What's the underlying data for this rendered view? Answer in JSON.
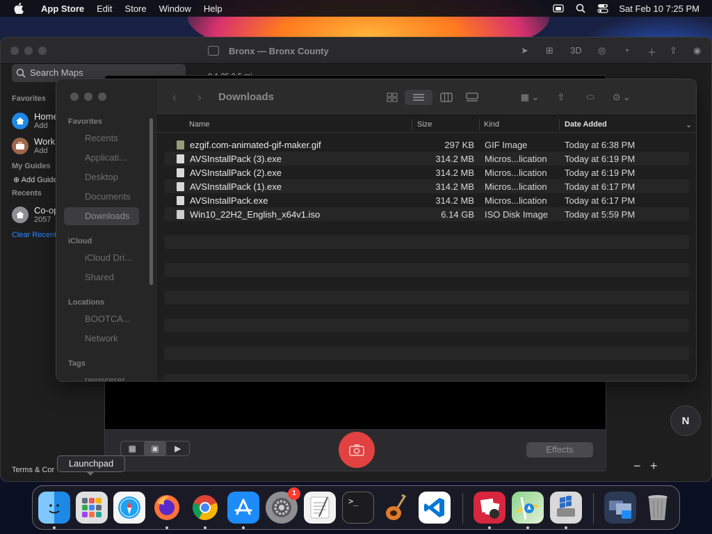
{
  "menubar": {
    "app_name": "App Store",
    "items": [
      "Edit",
      "Store",
      "Window",
      "Help"
    ],
    "clock": "Sat Feb 10  7:25 PM"
  },
  "maps": {
    "title": "Bronx — Bronx County",
    "toolbar_3d": "3D",
    "search_placeholder": "Search Maps",
    "favorites_heading": "Favorites",
    "favorites": [
      {
        "name": "Home",
        "sub": "Add"
      },
      {
        "name": "Work",
        "sub": "Add"
      }
    ],
    "guides_heading": "My Guides",
    "add_guide": "Add Guide",
    "recents_heading": "Recents",
    "recent": {
      "name": "Co-op",
      "sub": "2057"
    },
    "clear_recents": "Clear Recents",
    "terms": "Terms & Cor",
    "distances": "0      1.25      2.5 mi",
    "compass": "N",
    "zoom_out": "−",
    "zoom_in": "+"
  },
  "photobooth": {
    "effects_label": "Effects"
  },
  "finder": {
    "title": "Downloads",
    "sidebar": {
      "favorites_heading": "Favorites",
      "favorites": [
        "Recents",
        "Applicati...",
        "Desktop",
        "Documents",
        "Downloads"
      ],
      "icloud_heading": "iCloud",
      "icloud": [
        "iCloud Dri...",
        "Shared"
      ],
      "locations_heading": "Locations",
      "locations": [
        "BOOTCA...",
        "Network"
      ],
      "tags_heading": "Tags",
      "tags": [
        "rewwrerer"
      ]
    },
    "columns": {
      "name": "Name",
      "size": "Size",
      "kind": "Kind",
      "date": "Date Added"
    },
    "files": [
      {
        "name": "ezgif.com-animated-gif-maker.gif",
        "size": "297 KB",
        "kind": "GIF Image",
        "date": "Today at 6:38 PM"
      },
      {
        "name": "AVSInstallPack (3).exe",
        "size": "314.2 MB",
        "kind": "Micros...lication",
        "date": "Today at 6:19 PM"
      },
      {
        "name": "AVSInstallPack (2).exe",
        "size": "314.2 MB",
        "kind": "Micros...lication",
        "date": "Today at 6:19 PM"
      },
      {
        "name": "AVSInstallPack (1).exe",
        "size": "314.2 MB",
        "kind": "Micros...lication",
        "date": "Today at 6:17 PM"
      },
      {
        "name": "AVSInstallPack.exe",
        "size": "314.2 MB",
        "kind": "Micros...lication",
        "date": "Today at 6:17 PM"
      },
      {
        "name": "Win10_22H2_English_x64v1.iso",
        "size": "6.14 GB",
        "kind": "ISO Disk Image",
        "date": "Today at 5:59 PM"
      }
    ]
  },
  "tooltip": "Launchpad",
  "dock": {
    "apps": [
      {
        "name": "finder-icon",
        "color": "#1e88e5"
      },
      {
        "name": "launchpad-icon",
        "color": "#d9d9d9"
      },
      {
        "name": "safari-icon",
        "color": "#1ea1f2"
      },
      {
        "name": "firefox-icon",
        "color": "#ff7139"
      },
      {
        "name": "chrome-icon",
        "color": "#ffffff"
      },
      {
        "name": "app-store-icon",
        "color": "#1d8cf8"
      },
      {
        "name": "system-settings-icon",
        "color": "#8e8e93"
      },
      {
        "name": "textedit-icon",
        "color": "#f2f2f2"
      },
      {
        "name": "terminal-icon",
        "color": "#1c1c1e"
      },
      {
        "name": "garageband-icon",
        "color": "#3a2a1a"
      },
      {
        "name": "vscode-icon",
        "color": "#0078d4"
      },
      {
        "name": "photo-booth-icon",
        "color": "#d7263d"
      },
      {
        "name": "maps-icon",
        "color": "#4caf50"
      },
      {
        "name": "boot-camp-assistant-icon",
        "color": "#bdbdbd"
      },
      {
        "name": "downloads-stack-icon",
        "color": "#2b3a55"
      },
      {
        "name": "trash-icon",
        "color": "#9e9e9e"
      }
    ],
    "settings_badge": "1"
  }
}
